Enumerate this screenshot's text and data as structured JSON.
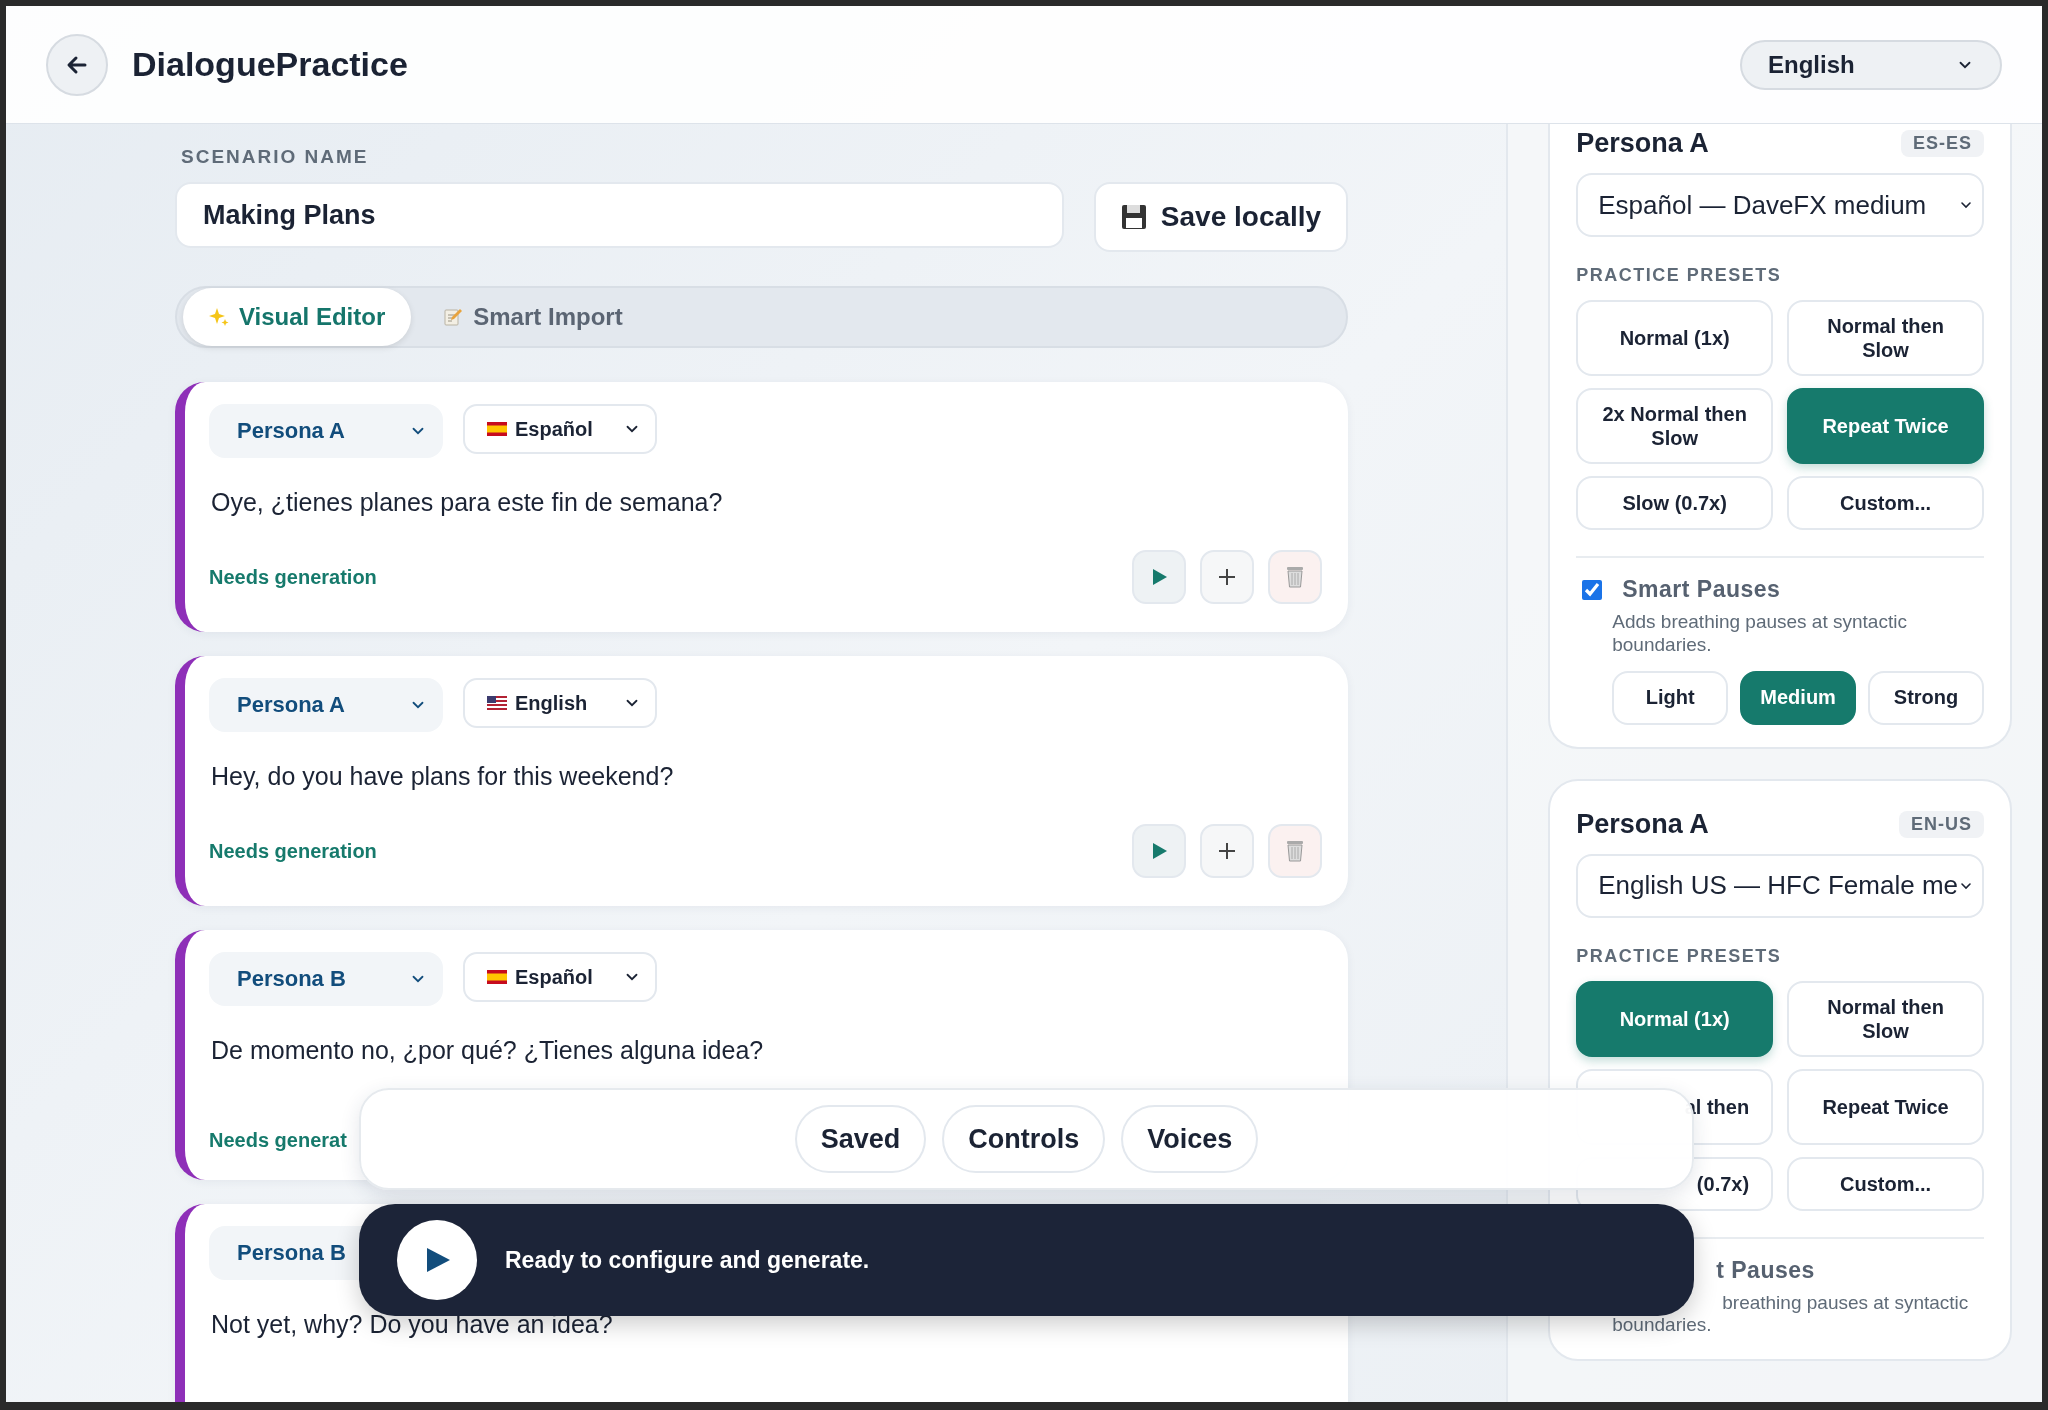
{
  "header": {
    "title": "DialoguePractice",
    "language": "English"
  },
  "scenario": {
    "label": "SCENARIO NAME",
    "value": "Making Plans",
    "save": "Save locally"
  },
  "editor_tabs": [
    {
      "label": "Visual Editor",
      "selected": true
    },
    {
      "label": "Smart Import",
      "selected": false
    }
  ],
  "lines": [
    {
      "kind": "spain",
      "persona": "Persona A",
      "language": "Español",
      "text": "Oye, ¿tienes planes para este fin de semana?",
      "status": "Needs generation",
      "actions": true
    },
    {
      "kind": "usa",
      "persona": "Persona A",
      "language": "English",
      "text": "Hey, do you have plans for this weekend?",
      "status": "Needs generation",
      "actions": true
    },
    {
      "kind": "spain",
      "persona": "Persona B",
      "language": "Español",
      "text": "De momento no, ¿por qué? ¿Tienes alguna idea?",
      "status": "Needs generat",
      "actions": false
    },
    {
      "persona": "Persona B",
      "text": "Not yet, why? Do you have an idea?",
      "actions": false
    }
  ],
  "voices": [
    {
      "persona": "Persona A",
      "locale": "ES-ES",
      "voice": "Español — DaveFX medium",
      "presets_label": "PRACTICE PRESETS",
      "presets": [
        {
          "label": "Normal (1x)",
          "selected": false,
          "kind": "full"
        },
        {
          "label": "Normal then Slow",
          "selected": false,
          "kind": "full"
        },
        {
          "label": "2x Normal then Slow",
          "selected": false,
          "kind": "full"
        },
        {
          "label": "Repeat Twice",
          "selected": true,
          "kind": "full"
        },
        {
          "label": "Slow (0.7x)",
          "selected": false,
          "kind": "full"
        },
        {
          "label": "Custom...",
          "selected": false,
          "kind": "full"
        }
      ],
      "pauses": {
        "kind": "full",
        "checked": true,
        "title": "Smart Pauses",
        "description": "Adds breathing pauses at syntactic boundaries.",
        "levels": [
          {
            "label": "Light",
            "selected": false
          },
          {
            "label": "Medium",
            "selected": true
          },
          {
            "label": "Strong",
            "selected": false
          }
        ]
      }
    },
    {
      "persona": "Persona A",
      "locale": "EN-US",
      "voice": "English US — HFC Female me",
      "presets_label": "PRACTICE PRESETS",
      "presets": [
        {
          "label": "Normal (1x)",
          "selected": true,
          "kind": "full"
        },
        {
          "label": "Normal then Slow",
          "selected": false,
          "kind": "full"
        },
        {
          "label": "al then",
          "selected": false,
          "kind": "clipped"
        },
        {
          "label": "Repeat Twice",
          "selected": false,
          "kind": "full"
        },
        {
          "label": "(0.7x)",
          "selected": false,
          "kind": "clipped"
        },
        {
          "label": "Custom...",
          "selected": false,
          "kind": "full"
        }
      ],
      "pauses": {
        "kind": "clipped",
        "title": "t Pauses",
        "description": "breathing pauses at syntactic boundaries."
      }
    }
  ],
  "bottom_tabs": [
    "Saved",
    "Controls",
    "Voices"
  ],
  "status": "Ready to configure and generate."
}
